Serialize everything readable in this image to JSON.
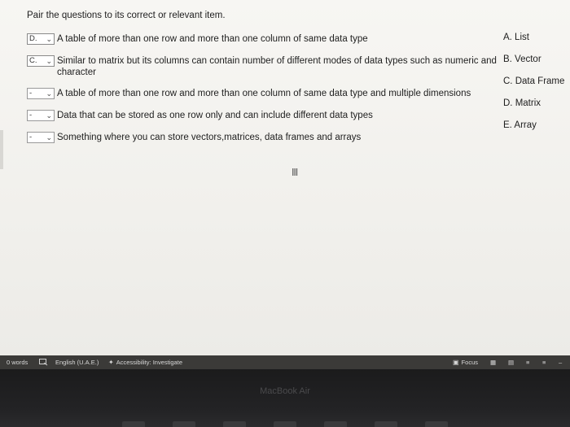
{
  "question": {
    "prompt": "Pair the questions to its correct or relevant item."
  },
  "pairs": [
    {
      "selected": "D.",
      "text": "A table of more than one row and more than one column of same data type"
    },
    {
      "selected": "C.",
      "text": "Similar to matrix but its columns can contain number of different modes of data types such as numeric and",
      "text_line2": "character"
    },
    {
      "selected": "-",
      "text": "A table of more than one row and more than one column of same data type and multiple dimensions"
    },
    {
      "selected": "-",
      "text": "Data that can be stored as one row only and can include different data types"
    },
    {
      "selected": "-",
      "text": "Something where you can store vectors,matrices, data frames and arrays"
    }
  ],
  "answers": [
    "A. List",
    "B. Vector",
    "C. Data Frame",
    "D. Matrix",
    "E. Array"
  ],
  "statusbar": {
    "words": "0 words",
    "language": "English (U.A.E.)",
    "accessibility": "Accessibility: Investigate",
    "focus": "Focus"
  },
  "bezel": {
    "brand": "MacBook Air"
  }
}
